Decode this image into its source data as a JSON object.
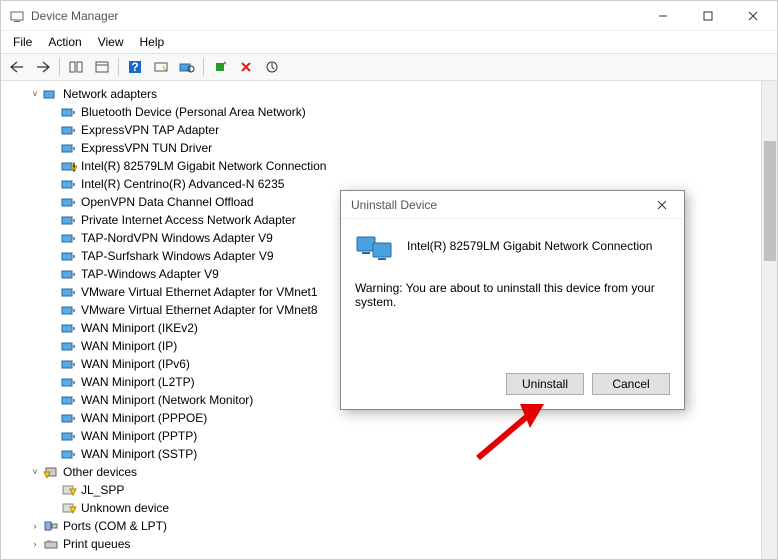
{
  "app": {
    "title": "Device Manager"
  },
  "menu": {
    "items": [
      "File",
      "Action",
      "View",
      "Help"
    ]
  },
  "tree": {
    "groups": [
      {
        "label": "Network adapters",
        "expanded": true,
        "items": [
          "Bluetooth Device (Personal Area Network)",
          "ExpressVPN TAP Adapter",
          "ExpressVPN TUN Driver",
          "Intel(R) 82579LM Gigabit Network Connection",
          "Intel(R) Centrino(R) Advanced-N 6235",
          "OpenVPN Data Channel Offload",
          "Private Internet Access Network Adapter",
          "TAP-NordVPN Windows Adapter V9",
          "TAP-Surfshark Windows Adapter V9",
          "TAP-Windows Adapter V9",
          "VMware Virtual Ethernet Adapter for VMnet1",
          "VMware Virtual Ethernet Adapter for VMnet8",
          "WAN Miniport (IKEv2)",
          "WAN Miniport (IP)",
          "WAN Miniport (IPv6)",
          "WAN Miniport (L2TP)",
          "WAN Miniport (Network Monitor)",
          "WAN Miniport (PPPOE)",
          "WAN Miniport (PPTP)",
          "WAN Miniport (SSTP)"
        ]
      },
      {
        "label": "Other devices",
        "expanded": true,
        "items": [
          "JL_SPP",
          "Unknown device"
        ]
      },
      {
        "label": "Ports (COM & LPT)",
        "expanded": false,
        "items": []
      },
      {
        "label": "Print queues",
        "expanded": false,
        "items": []
      }
    ],
    "warning_item_index": 3
  },
  "dialog": {
    "title": "Uninstall Device",
    "device": "Intel(R) 82579LM Gigabit Network Connection",
    "warning": "Warning: You are about to uninstall this device from your system.",
    "buttons": {
      "primary": "Uninstall",
      "secondary": "Cancel"
    }
  }
}
